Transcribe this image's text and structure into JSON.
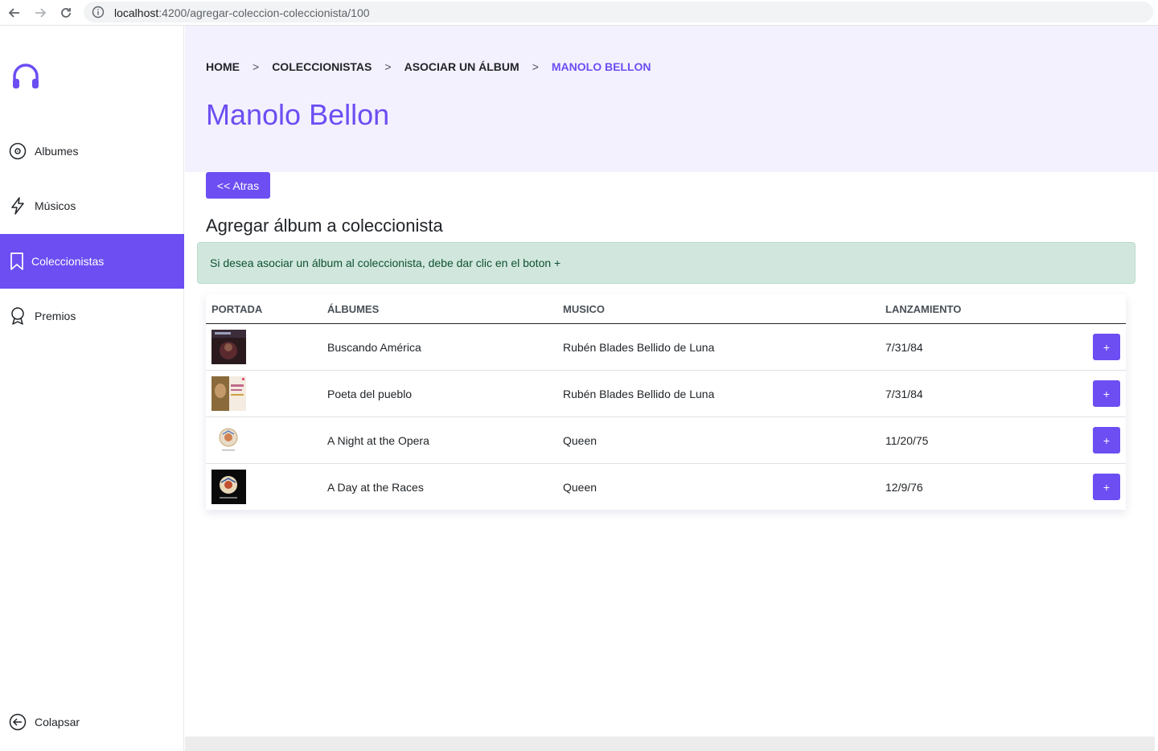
{
  "browser": {
    "url_host": "localhost",
    "url_path": ":4200/agregar-coleccion-coleccionista/100"
  },
  "sidebar": {
    "items": [
      {
        "label": "Albumes",
        "icon": "disc-icon"
      },
      {
        "label": "Músicos",
        "icon": "lightning-icon"
      },
      {
        "label": "Coleccionistas",
        "icon": "bookmark-icon"
      },
      {
        "label": "Premios",
        "icon": "award-icon"
      }
    ],
    "collapse_label": "Colapsar"
  },
  "breadcrumb": {
    "items": [
      "HOME",
      "COLECCIONISTAS",
      "ASOCIAR UN ÁLBUM",
      "MANOLO BELLON"
    ],
    "separator": ">"
  },
  "page": {
    "title": "Manolo Bellon",
    "back_label": "<< Atras",
    "section_title": "Agregar álbum a coleccionista",
    "alert_text": "Si desea asociar un álbum al coleccionista, debe dar clic en el boton +"
  },
  "table": {
    "headers": [
      "PORTADA",
      "ÁLBUMES",
      "MUSICO",
      "LANZAMIENTO",
      ""
    ],
    "rows": [
      {
        "album": "Buscando América",
        "musician": "Rubén Blades Bellido de Luna",
        "release": "7/31/84",
        "add_label": "+"
      },
      {
        "album": "Poeta del pueblo",
        "musician": "Rubén Blades Bellido de Luna",
        "release": "7/31/84",
        "add_label": "+"
      },
      {
        "album": "A Night at the Opera",
        "musician": "Queen",
        "release": "11/20/75",
        "add_label": "+"
      },
      {
        "album": "A Day at the Races",
        "musician": "Queen",
        "release": "12/9/76",
        "add_label": "+"
      }
    ]
  },
  "colors": {
    "accent": "#6c4ef2",
    "hero_bg": "#f4f1fe",
    "alert_bg": "#d1e7dd",
    "alert_text": "#0f5132"
  }
}
